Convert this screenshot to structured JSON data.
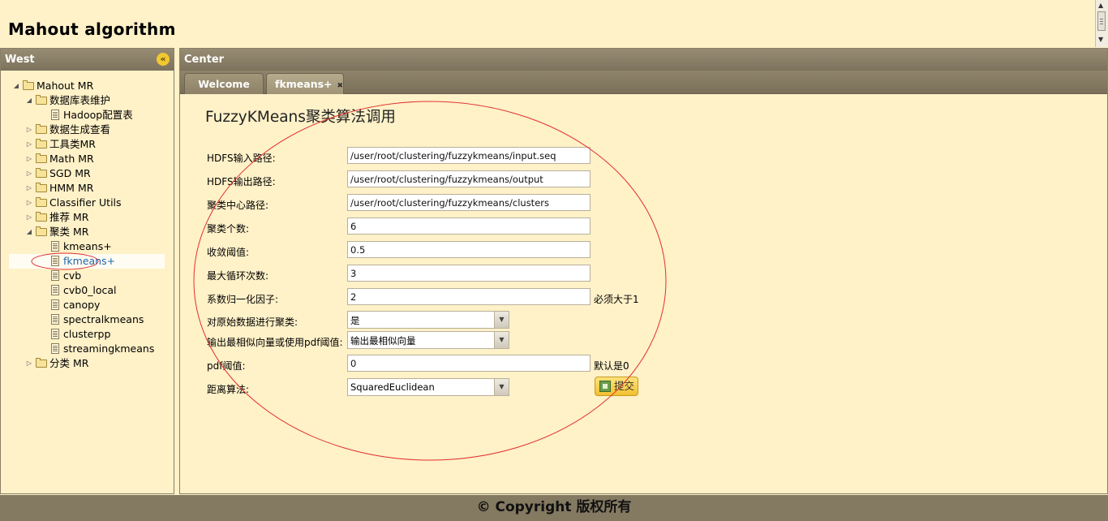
{
  "header": {
    "title": "Mahout algorithm"
  },
  "west": {
    "title": "West",
    "tree": [
      {
        "label": "Mahout MR",
        "type": "folder",
        "expanded": true,
        "level": 0
      },
      {
        "label": "数据库表维护",
        "type": "folder",
        "expanded": true,
        "level": 1
      },
      {
        "label": "Hadoop配置表",
        "type": "doc",
        "level": 2
      },
      {
        "label": "数据生成查看",
        "type": "folder",
        "expanded": false,
        "level": 1
      },
      {
        "label": "工具类MR",
        "type": "folder",
        "expanded": false,
        "level": 1
      },
      {
        "label": "Math MR",
        "type": "folder",
        "expanded": false,
        "level": 1
      },
      {
        "label": "SGD MR",
        "type": "folder",
        "expanded": false,
        "level": 1
      },
      {
        "label": "HMM MR",
        "type": "folder",
        "expanded": false,
        "level": 1
      },
      {
        "label": "Classifier Utils",
        "type": "folder",
        "expanded": false,
        "level": 1
      },
      {
        "label": "推荐 MR",
        "type": "folder",
        "expanded": false,
        "level": 1
      },
      {
        "label": "聚类 MR",
        "type": "folder",
        "expanded": true,
        "level": 1
      },
      {
        "label": "kmeans+",
        "type": "doc",
        "level": 2
      },
      {
        "label": "fkmeans+",
        "type": "doc",
        "level": 2,
        "selected": true
      },
      {
        "label": "cvb",
        "type": "doc",
        "level": 2
      },
      {
        "label": "cvb0_local",
        "type": "doc",
        "level": 2
      },
      {
        "label": "canopy",
        "type": "doc",
        "level": 2
      },
      {
        "label": "spectralkmeans",
        "type": "doc",
        "level": 2
      },
      {
        "label": "clusterpp",
        "type": "doc",
        "level": 2
      },
      {
        "label": "streamingkmeans",
        "type": "doc",
        "level": 2
      },
      {
        "label": "分类 MR",
        "type": "folder",
        "expanded": false,
        "level": 1
      }
    ]
  },
  "center": {
    "title": "Center",
    "tabs": [
      {
        "label": "Welcome"
      },
      {
        "label": "fkmeans+",
        "active": true,
        "closable": true
      }
    ]
  },
  "form": {
    "title": "FuzzyKMeans聚类算法调用",
    "input_label": "HDFS输入路径:",
    "input_value": "/user/root/clustering/fuzzykmeans/input.seq",
    "output_label": "HDFS输出路径:",
    "output_value": "/user/root/clustering/fuzzykmeans/output",
    "clusters_label": "聚类中心路径:",
    "clusters_value": "/user/root/clustering/fuzzykmeans/clusters",
    "k_label": "聚类个数:",
    "k_value": "6",
    "convergence_label": "收敛阈值:",
    "convergence_value": "0.5",
    "maxiter_label": "最大循环次数:",
    "maxiter_value": "3",
    "m_label": "系数归一化因子:",
    "m_value": "2",
    "m_hint": "必须大于1",
    "cluster_data_label": "对原始数据进行聚类:",
    "cluster_data_value": "是",
    "emit_label": "输出最相似向量或使用pdf阈值:",
    "emit_value": "输出最相似向量",
    "pdf_label": "pdf阈值:",
    "pdf_value": "0",
    "pdf_hint": "默认是0",
    "distance_label": "距离算法:",
    "distance_value": "SquaredEuclidean",
    "submit_label": "提交"
  },
  "footer": {
    "text": "© Copyright 版权所有"
  },
  "colors": {
    "background": "#fff1c8",
    "panel_header": "#8a7f68",
    "annotation": "#e03030",
    "submit_button": "#f2c030"
  }
}
